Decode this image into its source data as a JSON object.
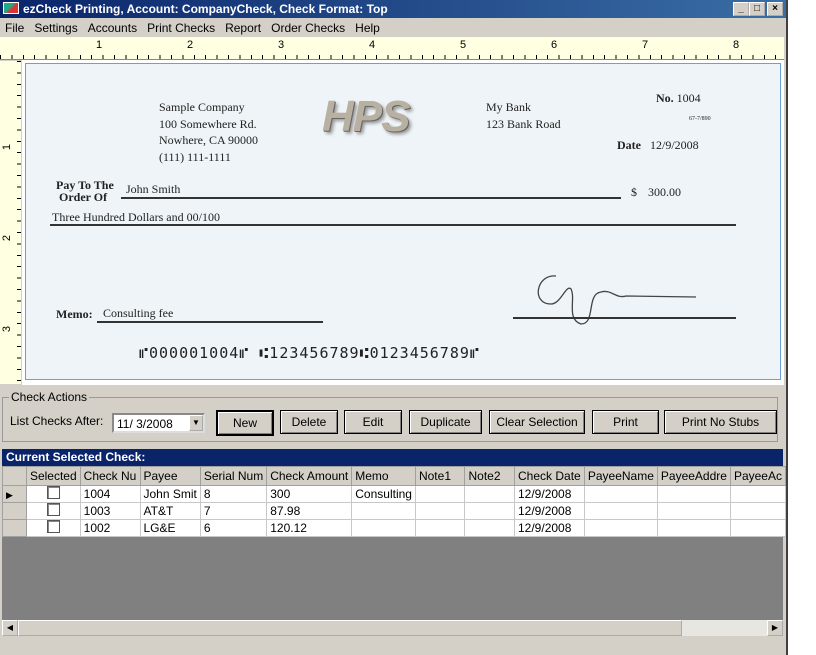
{
  "window": {
    "title": "ezCheck Printing, Account: CompanyCheck, Check Format: Top",
    "controls": [
      "_",
      "□",
      "×"
    ]
  },
  "menu": [
    "File",
    "Settings",
    "Accounts",
    "Print Checks",
    "Report",
    "Order Checks",
    "Help"
  ],
  "ruler": {
    "h": [
      "1",
      "2",
      "3",
      "4",
      "5",
      "6",
      "7",
      "8"
    ],
    "v": [
      "1",
      "2",
      "3"
    ]
  },
  "check": {
    "company": [
      "Sample Company",
      "100 Somewhere Rd.",
      "Nowhere, CA 90000",
      "(111) 111-1111"
    ],
    "logo": "HPS",
    "bank": [
      "My Bank",
      "123 Bank Road"
    ],
    "no_label": "No.",
    "number": "1004",
    "routing_fraction": "67-7/890",
    "date_label": "Date",
    "date": "12/9/2008",
    "pay_label_1": "Pay To The",
    "pay_label_2": "Order Of",
    "payee": "John Smith",
    "currency": "$",
    "amount": "300.00",
    "amount_words": "Three Hundred  Dollars and 00/100",
    "memo_label": "Memo:",
    "memo": "Consulting fee",
    "micr": "⑈000001004⑈ ⑆123456789⑆0123456789⑈"
  },
  "actions": {
    "legend": "Check Actions",
    "list_after_label": "List Checks After:",
    "list_after_value": "11/ 3/2008",
    "buttons": [
      "New",
      "Delete",
      "Edit",
      "Duplicate",
      "Clear Selection",
      "Print",
      "Print No Stubs"
    ]
  },
  "grid": {
    "title": "Current Selected Check:",
    "columns": [
      "Selected",
      "Check Nu",
      "Payee",
      "Serial Num",
      "Check Amount",
      "Memo",
      "Note1",
      "Note2",
      "Check Date",
      "PayeeName",
      "PayeeAddre",
      "PayeeAc"
    ],
    "rows": [
      [
        "",
        "1004",
        "John Smit",
        "8",
        "300",
        "Consulting",
        "",
        "",
        "12/9/2008",
        "",
        "",
        ""
      ],
      [
        "",
        "1003",
        "AT&T",
        "7",
        "87.98",
        "",
        "",
        "",
        "12/9/2008",
        "",
        "",
        ""
      ],
      [
        "",
        "1002",
        "LG&E",
        "6",
        "120.12",
        "",
        "",
        "",
        "12/9/2008",
        "",
        "",
        ""
      ]
    ]
  }
}
